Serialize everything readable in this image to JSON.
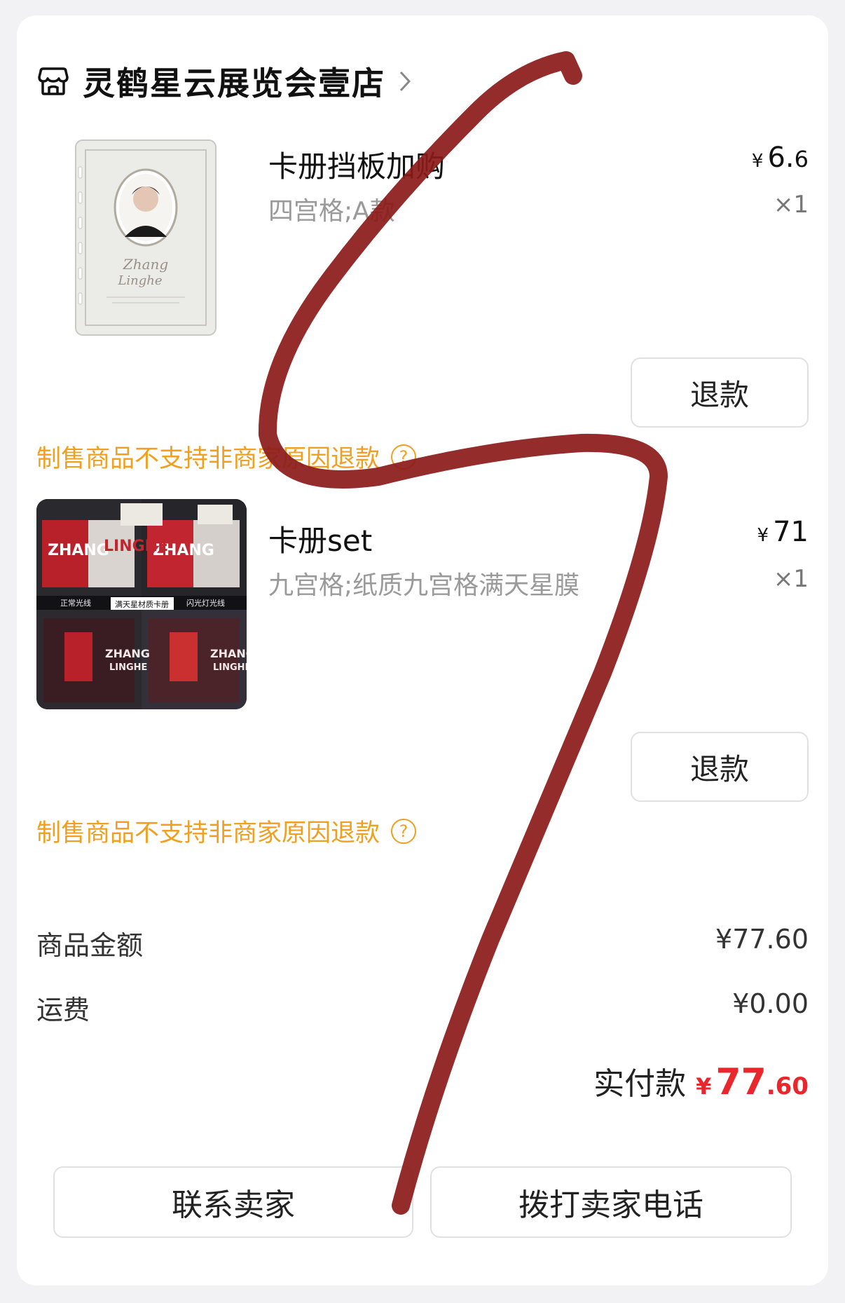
{
  "shop": {
    "name": "灵鹤星云展览会壹店",
    "icon": "store-icon",
    "arrow": "chevron-right-icon"
  },
  "items": [
    {
      "name": "卡册挡板加购",
      "spec": "四宫格;A款",
      "price_currency": "¥",
      "price_int": "6.",
      "price_dec": "6",
      "qty": "×1",
      "refund_label": "退款",
      "notice": "制售商品不支持非商家原因退款",
      "thumb_text": "Zhang Linghe"
    },
    {
      "name": "卡册set",
      "spec": "九宫格;纸质九宫格满天星膜",
      "price_currency": "¥",
      "price_int": "71",
      "price_dec": "",
      "qty": "×1",
      "refund_label": "退款",
      "notice": "制售商品不支持非商家原因退款",
      "thumb_labels": [
        "正常光线",
        "满天星材质卡册",
        "闪光灯光线",
        "ZHANG",
        "LINGHE"
      ]
    }
  ],
  "summary": {
    "goods_label": "商品金额",
    "goods_value": "¥77.60",
    "shipping_label": "运费",
    "shipping_value": "¥0.00",
    "paid_label": "实付款",
    "paid_currency": "¥",
    "paid_int": "77",
    "paid_dec": ".60"
  },
  "actions": {
    "contact_seller": "联系卖家",
    "call_seller": "拨打卖家电话"
  },
  "colors": {
    "accent_red": "#e8262c",
    "notice_orange": "#f0a020",
    "scribble": "#8b1a1a"
  }
}
